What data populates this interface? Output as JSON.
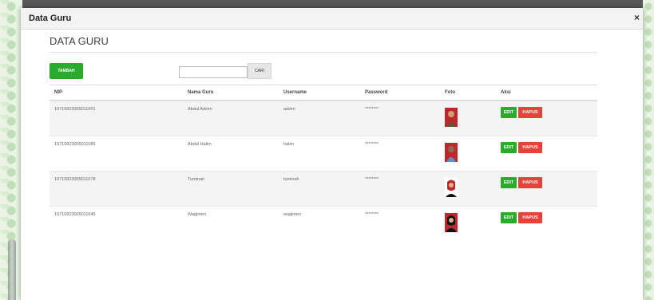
{
  "dialog": {
    "title": "Data Guru",
    "close_label": "×"
  },
  "page": {
    "heading": "DATA GURU"
  },
  "toolbar": {
    "add_label": "TAMBAH",
    "search_value": "",
    "search_label": "CARI"
  },
  "table": {
    "headers": [
      "NIP",
      "Nama Guru",
      "Username",
      "Password",
      "Foto",
      "Aksi"
    ],
    "rows": [
      {
        "nip": "19710823005011001",
        "nama": "Abdul Adzim",
        "username": "adzim",
        "password": "********"
      },
      {
        "nip": "19710823005011085",
        "nama": "Abdul Halim",
        "username": "halim",
        "password": "********"
      },
      {
        "nip": "19710823005011078",
        "nama": "Tuminah",
        "username": "tuminah",
        "password": "********"
      },
      {
        "nip": "19710823005011045",
        "nama": "Waginten",
        "username": "waginten",
        "password": "********"
      }
    ],
    "edit_label": "EDIT",
    "delete_label": "HAPUS"
  },
  "colors": {
    "accent_green": "#2aab2e",
    "danger_red": "#e8413a",
    "photo_bg": "#c0272d"
  }
}
